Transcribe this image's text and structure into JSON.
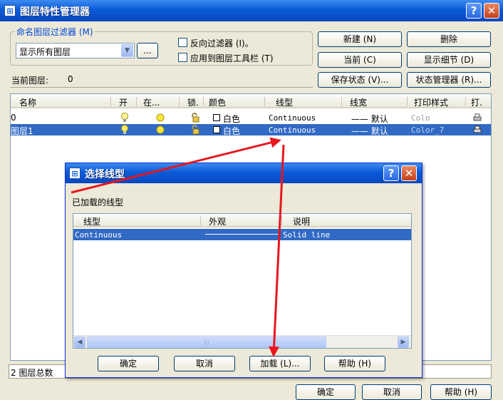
{
  "window": {
    "title": "图层特性管理器",
    "help_btn": "?",
    "close_btn": "✕"
  },
  "filter": {
    "group_label": "命名图层过滤器 (M)",
    "combo_value": "显示所有图层",
    "browse_label": "...",
    "reverse_label": "反向过滤器 (I)。",
    "apply_label": "应用到图层工具栏 (T)"
  },
  "buttons": {
    "new": "新建 (N)",
    "delete": "删除",
    "current": "当前 (C)",
    "show_details": "显示细节 (D)",
    "save_state": "保存状态 (V)...",
    "state_manager": "状态管理器 (R)..."
  },
  "current_layer": {
    "label": "当前图层:",
    "value": "0"
  },
  "layer_table": {
    "columns": [
      "名称",
      "开",
      "在...",
      "锁.",
      "颜色",
      "线型",
      "线宽",
      "打印样式",
      "打."
    ],
    "rows": [
      {
        "name": "0",
        "color": "白色",
        "linetype": "Continuous",
        "lineweight": "—— 默认",
        "plot_style": "Colo",
        "selected": false
      },
      {
        "name": "图层1",
        "color": "白色",
        "linetype": "Continuous",
        "lineweight": "—— 默认",
        "plot_style": "Color_7",
        "selected": true
      }
    ]
  },
  "status": {
    "total": "2 图层总数"
  },
  "bottom": {
    "ok": "确定",
    "cancel": "取消",
    "help": "帮助 (H)"
  },
  "dialog": {
    "title": "选择线型",
    "help_btn": "?",
    "close_btn": "✕",
    "loaded_label": "已加载的线型",
    "columns": [
      "线型",
      "外观",
      "说明"
    ],
    "rows": [
      {
        "linetype": "Continuous",
        "description": "Solid line"
      }
    ],
    "ok": "确定",
    "cancel": "取消",
    "load": "加载 (L)...",
    "help": "帮助 (H)",
    "scroll_thumb": "|||"
  },
  "colors": {
    "title_bar": "#0a5ad8",
    "selection": "#316ac5",
    "annotation_arrow": "#e8161e"
  }
}
